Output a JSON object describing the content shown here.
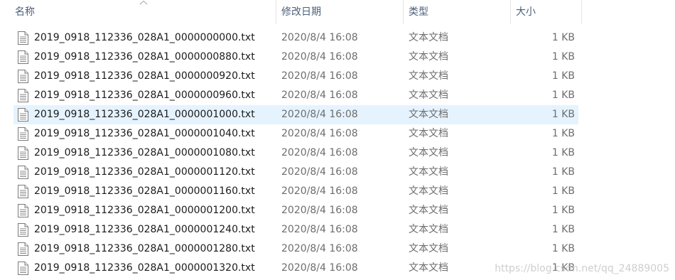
{
  "columns": {
    "name": "名称",
    "date": "修改日期",
    "type": "类型",
    "size": "大小"
  },
  "sort": {
    "column": "name",
    "direction": "ascending",
    "icon": "sort-up-chevron-icon"
  },
  "files": [
    {
      "name": "2019_0918_112336_028A1_0000000000.txt",
      "date": "2020/8/4 16:08",
      "type": "文本文档",
      "size": "1 KB",
      "selected": false
    },
    {
      "name": "2019_0918_112336_028A1_0000000880.txt",
      "date": "2020/8/4 16:08",
      "type": "文本文档",
      "size": "1 KB",
      "selected": false
    },
    {
      "name": "2019_0918_112336_028A1_0000000920.txt",
      "date": "2020/8/4 16:08",
      "type": "文本文档",
      "size": "1 KB",
      "selected": false
    },
    {
      "name": "2019_0918_112336_028A1_0000000960.txt",
      "date": "2020/8/4 16:08",
      "type": "文本文档",
      "size": "1 KB",
      "selected": false
    },
    {
      "name": "2019_0918_112336_028A1_0000001000.txt",
      "date": "2020/8/4 16:08",
      "type": "文本文档",
      "size": "1 KB",
      "selected": true
    },
    {
      "name": "2019_0918_112336_028A1_0000001040.txt",
      "date": "2020/8/4 16:08",
      "type": "文本文档",
      "size": "1 KB",
      "selected": false
    },
    {
      "name": "2019_0918_112336_028A1_0000001080.txt",
      "date": "2020/8/4 16:08",
      "type": "文本文档",
      "size": "1 KB",
      "selected": false
    },
    {
      "name": "2019_0918_112336_028A1_0000001120.txt",
      "date": "2020/8/4 16:08",
      "type": "文本文档",
      "size": "1 KB",
      "selected": false
    },
    {
      "name": "2019_0918_112336_028A1_0000001160.txt",
      "date": "2020/8/4 16:08",
      "type": "文本文档",
      "size": "1 KB",
      "selected": false
    },
    {
      "name": "2019_0918_112336_028A1_0000001200.txt",
      "date": "2020/8/4 16:08",
      "type": "文本文档",
      "size": "1 KB",
      "selected": false
    },
    {
      "name": "2019_0918_112336_028A1_0000001240.txt",
      "date": "2020/8/4 16:08",
      "type": "文本文档",
      "size": "1 KB",
      "selected": false
    },
    {
      "name": "2019_0918_112336_028A1_0000001280.txt",
      "date": "2020/8/4 16:08",
      "type": "文本文档",
      "size": "1 KB",
      "selected": false
    },
    {
      "name": "2019_0918_112336_028A1_0000001320.txt",
      "date": "2020/8/4 16:08",
      "type": "文本文档",
      "size": "1 KB",
      "selected": false
    }
  ],
  "file_icon": "text-document-icon",
  "colors": {
    "header_text": "#4c607a",
    "selection": "#e5f3ff",
    "secondary_text": "#6d6d6d"
  },
  "watermark": "https://blog.csdn.net/qq_24889005"
}
